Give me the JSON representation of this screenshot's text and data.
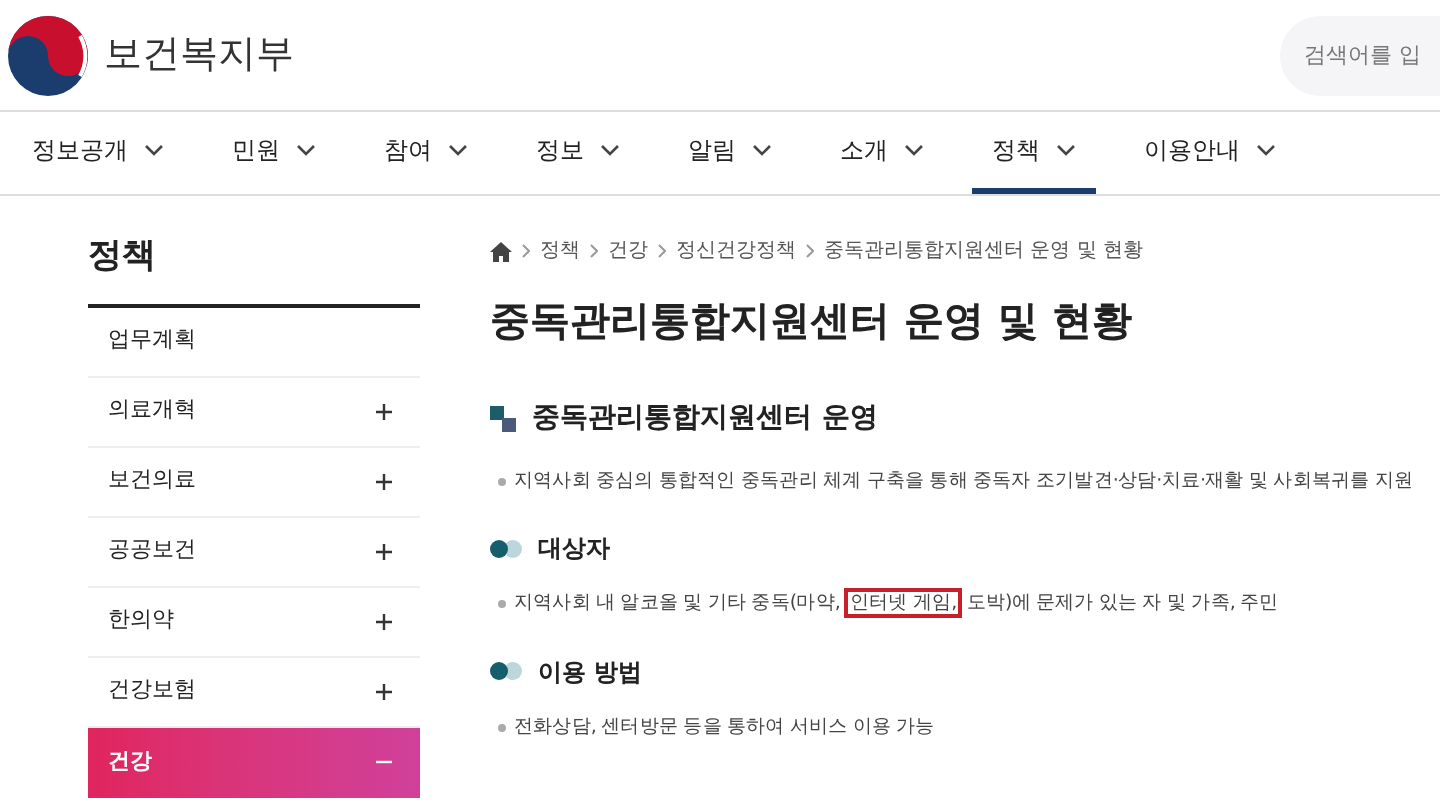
{
  "header": {
    "logo_text": "보건복지부",
    "search": {
      "placeholder": "검색어를 입"
    }
  },
  "nav": [
    {
      "label": "정보공개",
      "selected": false
    },
    {
      "label": "민원",
      "selected": false
    },
    {
      "label": "참여",
      "selected": false
    },
    {
      "label": "정보",
      "selected": false
    },
    {
      "label": "알림",
      "selected": false
    },
    {
      "label": "소개",
      "selected": false
    },
    {
      "label": "정책",
      "selected": true
    },
    {
      "label": "이용안내",
      "selected": false
    }
  ],
  "sidebar": {
    "title": "정책",
    "items": [
      {
        "label": "업무계획",
        "expandable": false,
        "selected": false
      },
      {
        "label": "의료개혁",
        "expandable": true,
        "expanded": false,
        "selected": false
      },
      {
        "label": "보건의료",
        "expandable": true,
        "expanded": false,
        "selected": false
      },
      {
        "label": "공공보건",
        "expandable": true,
        "expanded": false,
        "selected": false
      },
      {
        "label": "한의약",
        "expandable": true,
        "expanded": false,
        "selected": false
      },
      {
        "label": "건강보험",
        "expandable": true,
        "expanded": false,
        "selected": false
      },
      {
        "label": "건강",
        "expandable": true,
        "expanded": true,
        "selected": true
      }
    ]
  },
  "breadcrumb": [
    "정책",
    "건강",
    "정신건강정책",
    "중독관리통합지원센터 운영 및 현황"
  ],
  "title": "중독관리통합지원센터 운영 및 현황",
  "sections": [
    {
      "kind": "main",
      "heading": "중독관리통합지원센터 운영",
      "bullets": [
        [
          {
            "text": "지역사회 중심의 통합적인 중독관리 체계 구축을 통해 중독자 조기발견·상담·치료·재활 및 사회복귀를 지원",
            "boxed": false
          }
        ]
      ]
    },
    {
      "kind": "sub",
      "heading": "대상자",
      "bullets": [
        [
          {
            "text": "지역사회 내 알코올 및 기타 중독(마약,",
            "boxed": false
          },
          {
            "text": "인터넷 게임,",
            "boxed": true
          },
          {
            "text": "도박)에 문제가 있는 자 및 가족, 주민",
            "boxed": false
          }
        ]
      ]
    },
    {
      "kind": "sub",
      "heading": "이용 방법",
      "bullets": [
        [
          {
            "text": "전화상담, 센터방문 등을 통하여 서비스 이용 가능",
            "boxed": false
          }
        ]
      ]
    }
  ]
}
